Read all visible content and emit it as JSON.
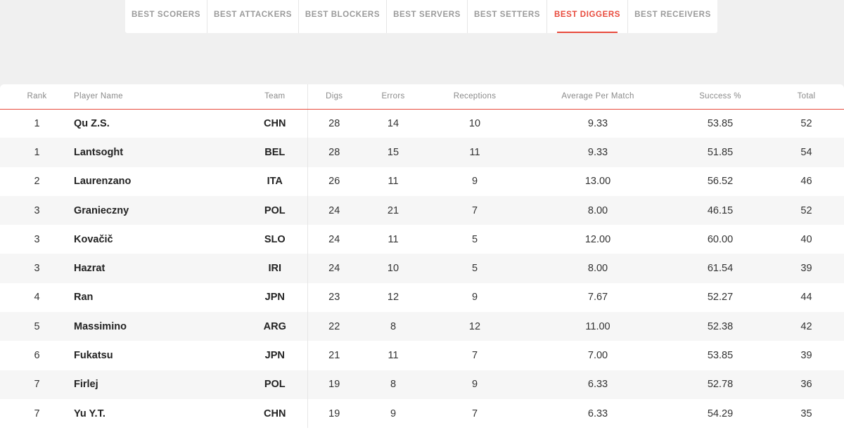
{
  "tabs": [
    {
      "label": "BEST SCORERS",
      "active": false
    },
    {
      "label": "BEST ATTACKERS",
      "active": false
    },
    {
      "label": "BEST BLOCKERS",
      "active": false
    },
    {
      "label": "BEST SERVERS",
      "active": false
    },
    {
      "label": "BEST SETTERS",
      "active": false
    },
    {
      "label": "BEST DIGGERS",
      "active": true
    },
    {
      "label": "BEST RECEIVERS",
      "active": false
    }
  ],
  "accent_color": "#e84a3c",
  "table": {
    "headers": {
      "rank": "Rank",
      "player": "Player Name",
      "team": "Team",
      "digs": "Digs",
      "errors": "Errors",
      "receptions": "Receptions",
      "avg": "Average Per Match",
      "success": "Success %",
      "total": "Total"
    },
    "rows": [
      {
        "rank": "1",
        "player": "Qu Z.S.",
        "team": "CHN",
        "digs": "28",
        "errors": "14",
        "receptions": "10",
        "avg": "9.33",
        "success": "53.85",
        "total": "52"
      },
      {
        "rank": "1",
        "player": "Lantsoght",
        "team": "BEL",
        "digs": "28",
        "errors": "15",
        "receptions": "11",
        "avg": "9.33",
        "success": "51.85",
        "total": "54"
      },
      {
        "rank": "2",
        "player": "Laurenzano",
        "team": "ITA",
        "digs": "26",
        "errors": "11",
        "receptions": "9",
        "avg": "13.00",
        "success": "56.52",
        "total": "46"
      },
      {
        "rank": "3",
        "player": "Granieczny",
        "team": "POL",
        "digs": "24",
        "errors": "21",
        "receptions": "7",
        "avg": "8.00",
        "success": "46.15",
        "total": "52"
      },
      {
        "rank": "3",
        "player": "Kovačič",
        "team": "SLO",
        "digs": "24",
        "errors": "11",
        "receptions": "5",
        "avg": "12.00",
        "success": "60.00",
        "total": "40"
      },
      {
        "rank": "3",
        "player": "Hazrat",
        "team": "IRI",
        "digs": "24",
        "errors": "10",
        "receptions": "5",
        "avg": "8.00",
        "success": "61.54",
        "total": "39"
      },
      {
        "rank": "4",
        "player": "Ran",
        "team": "JPN",
        "digs": "23",
        "errors": "12",
        "receptions": "9",
        "avg": "7.67",
        "success": "52.27",
        "total": "44"
      },
      {
        "rank": "5",
        "player": "Massimino",
        "team": "ARG",
        "digs": "22",
        "errors": "8",
        "receptions": "12",
        "avg": "11.00",
        "success": "52.38",
        "total": "42"
      },
      {
        "rank": "6",
        "player": "Fukatsu",
        "team": "JPN",
        "digs": "21",
        "errors": "11",
        "receptions": "7",
        "avg": "7.00",
        "success": "53.85",
        "total": "39"
      },
      {
        "rank": "7",
        "player": "Firlej",
        "team": "POL",
        "digs": "19",
        "errors": "8",
        "receptions": "9",
        "avg": "6.33",
        "success": "52.78",
        "total": "36"
      },
      {
        "rank": "7",
        "player": "Yu Y.T.",
        "team": "CHN",
        "digs": "19",
        "errors": "9",
        "receptions": "7",
        "avg": "6.33",
        "success": "54.29",
        "total": "35"
      }
    ]
  }
}
